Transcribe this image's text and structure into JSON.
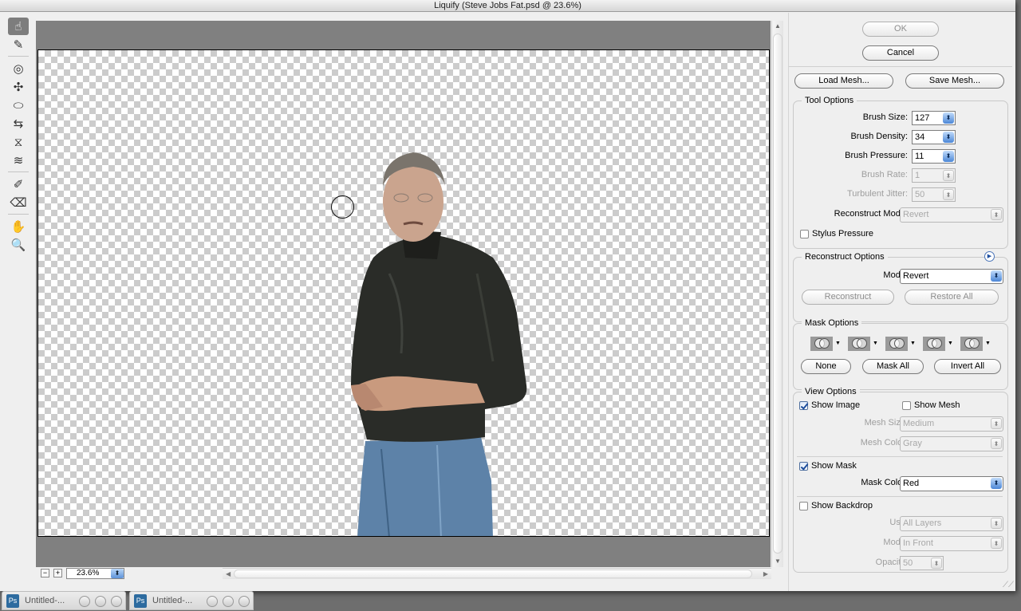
{
  "window": {
    "title": "Liquify (Steve Jobs Fat.psd @ 23.6%)"
  },
  "toolbar": {
    "tools": [
      {
        "name": "forward-warp-tool",
        "glyph": "☝"
      },
      {
        "name": "reconstruct-tool",
        "glyph": "✎"
      },
      {
        "name": "twirl-clockwise-tool",
        "glyph": "◎"
      },
      {
        "name": "pucker-tool",
        "glyph": "✣"
      },
      {
        "name": "bloat-tool",
        "glyph": "⬭"
      },
      {
        "name": "push-left-tool",
        "glyph": "⇆"
      },
      {
        "name": "mirror-tool",
        "glyph": "⧖"
      },
      {
        "name": "turbulence-tool",
        "glyph": "≋"
      },
      {
        "name": "freeze-mask-tool",
        "glyph": "✐"
      },
      {
        "name": "thaw-mask-tool",
        "glyph": "⌫"
      },
      {
        "name": "hand-tool",
        "glyph": "✋"
      },
      {
        "name": "zoom-tool",
        "glyph": "🔍"
      }
    ]
  },
  "canvas": {
    "zoom_value": "23.6%",
    "zoom_out_label": "−",
    "zoom_in_label": "+"
  },
  "buttons": {
    "ok": "OK",
    "cancel": "Cancel",
    "load_mesh": "Load Mesh...",
    "save_mesh": "Save Mesh..."
  },
  "tool_options": {
    "title": "Tool Options",
    "brush_size_label": "Brush Size:",
    "brush_size": "127",
    "brush_density_label": "Brush Density:",
    "brush_density": "34",
    "brush_pressure_label": "Brush Pressure:",
    "brush_pressure": "11",
    "brush_rate_label": "Brush Rate:",
    "brush_rate": "1",
    "turbulent_jitter_label": "Turbulent Jitter:",
    "turbulent_jitter": "50",
    "reconstruct_mode_label": "Reconstruct Mode:",
    "reconstruct_mode": "Revert",
    "stylus_pressure_label": "Stylus Pressure",
    "stylus_pressure": false
  },
  "reconstruct_options": {
    "title": "Reconstruct Options",
    "mode_label": "Mode:",
    "mode": "Revert",
    "reconstruct_button": "Reconstruct",
    "restore_all_button": "Restore All"
  },
  "mask_options": {
    "title": "Mask Options",
    "modes": [
      "replace-selection",
      "add-to-selection",
      "subtract-from-selection",
      "intersect-with-selection",
      "invert-selection"
    ],
    "none_button": "None",
    "mask_all_button": "Mask All",
    "invert_all_button": "Invert All"
  },
  "view_options": {
    "title": "View Options",
    "show_image_label": "Show Image",
    "show_image": true,
    "show_mesh_label": "Show Mesh",
    "show_mesh": false,
    "mesh_size_label": "Mesh Size:",
    "mesh_size": "Medium",
    "mesh_color_label": "Mesh Color:",
    "mesh_color": "Gray",
    "show_mask_label": "Show Mask",
    "show_mask": true,
    "mask_color_label": "Mask Color:",
    "mask_color": "Red",
    "show_backdrop_label": "Show Backdrop",
    "show_backdrop": false,
    "use_label": "Use:",
    "use": "All Layers",
    "mode_label": "Mode:",
    "mode": "In Front",
    "opacity_label": "Opacity:",
    "opacity": "50"
  },
  "taskbar": {
    "items": [
      {
        "label": "Untitled-..."
      },
      {
        "label": "Untitled-..."
      }
    ]
  }
}
